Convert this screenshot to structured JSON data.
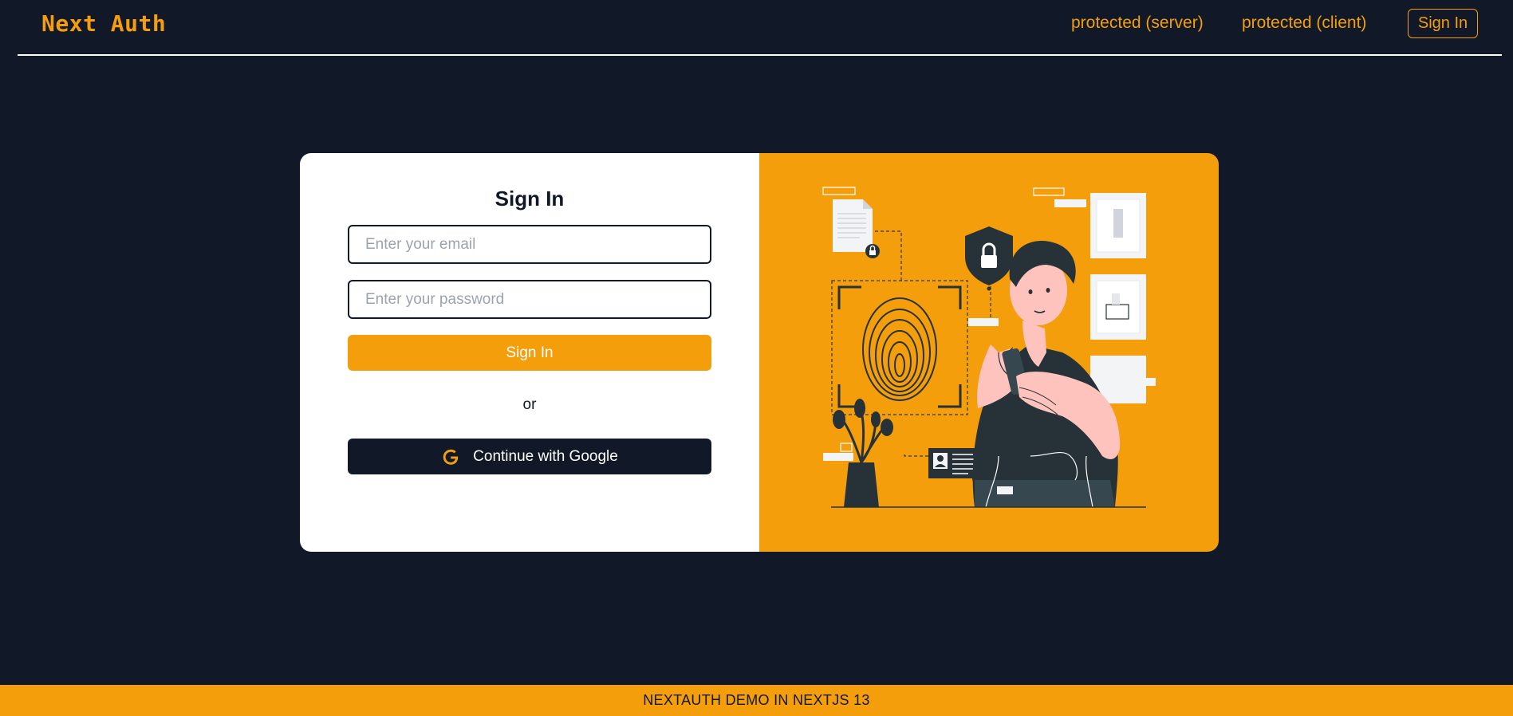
{
  "navbar": {
    "logo": "Next Auth",
    "links": [
      {
        "label": "protected (server)"
      },
      {
        "label": "protected (client)"
      }
    ],
    "signin_label": "Sign In"
  },
  "form": {
    "title": "Sign In",
    "email_placeholder": "Enter your email",
    "password_placeholder": "Enter your password",
    "submit_label": "Sign In",
    "divider": "or",
    "google_label": "Continue with Google",
    "google_icon": "google-g-icon"
  },
  "illustration": {
    "subject": "person-with-phone-fingerprint-security-icon"
  },
  "footer": {
    "text": "NEXTAUTH DEMO IN NEXTJS 13"
  },
  "colors": {
    "background": "#111827",
    "accent": "#f59e0b",
    "card": "#ffffff"
  }
}
